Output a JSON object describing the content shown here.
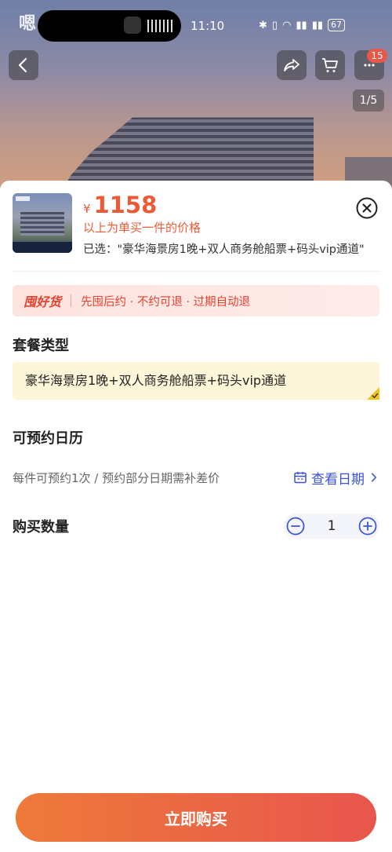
{
  "status_bar": {
    "time": "11:10",
    "icons": [
      "bluetooth-icon",
      "vibrate-icon",
      "wifi-icon",
      "5g-signal-icon",
      "5g-signal-icon"
    ],
    "battery": "67"
  },
  "hero": {
    "app_logo_text": "嗯",
    "page_indicator": "1/5",
    "cart_badge": "15"
  },
  "product": {
    "currency": "¥",
    "price": "1158",
    "price_note": "以上为单买一件的价格",
    "selected_label": "已选：\"豪华海景房1晚+双人商务舱船票+码头vip通道\""
  },
  "promo": {
    "brand": "囤好货",
    "description": "先囤后约 · 不约可退 · 过期自动退"
  },
  "package": {
    "title": "套餐类型",
    "options": [
      {
        "label": "豪华海景房1晚+双人商务舱船票+码头vip通道",
        "selected": true
      }
    ]
  },
  "calendar": {
    "title": "可预约日历",
    "hint": "每件可预约1次 / 预约部分日期需补差价",
    "link_label": "查看日期"
  },
  "quantity": {
    "title": "购买数量",
    "value": "1"
  },
  "footer": {
    "buy_label": "立即购买"
  },
  "colors": {
    "accent": "#ec5b36",
    "link": "#3a52d6",
    "selected_bg": "#fdf6d8",
    "buy_gradient_start": "#ee7a3a",
    "buy_gradient_end": "#e8554d"
  }
}
